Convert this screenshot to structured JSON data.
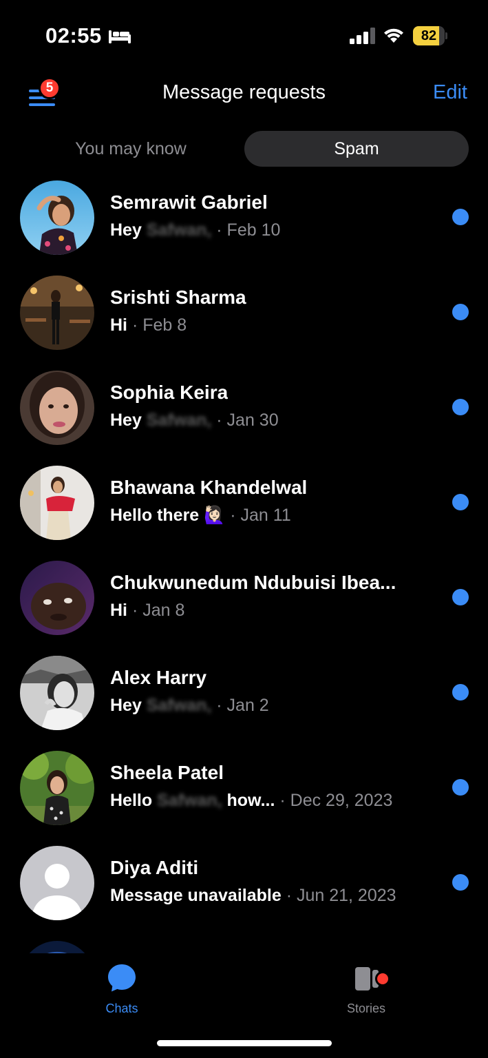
{
  "status_bar": {
    "time": "02:55",
    "battery": "82",
    "battery_level": 0.82,
    "icons": [
      "bed-icon",
      "signal-icon",
      "wifi-icon",
      "battery-icon"
    ]
  },
  "header": {
    "menu_badge": "5",
    "title": "Message requests",
    "edit_label": "Edit"
  },
  "tabs": [
    {
      "label": "You may know",
      "selected": false
    },
    {
      "label": "Spam",
      "selected": true
    }
  ],
  "requests": [
    {
      "name": "Semrawit Gabriel",
      "message": "Hey",
      "blurred": "Safwan,",
      "date": "Feb 10",
      "unread": true
    },
    {
      "name": "Srishti Sharma",
      "message": "Hi",
      "blurred": "",
      "date": "Feb 8",
      "unread": true
    },
    {
      "name": "Sophia Keira",
      "message": "Hey",
      "blurred": "Safwan,",
      "date": "Jan 30",
      "unread": true
    },
    {
      "name": "Bhawana Khandelwal",
      "message": "Hello there 🙋🏻‍♀️",
      "blurred": "",
      "date": "Jan 11",
      "unread": true
    },
    {
      "name": "Chukwunedum Ndubuisi Ibea...",
      "message": "Hi",
      "blurred": "",
      "date": "Jan 8",
      "unread": true
    },
    {
      "name": "Alex Harry",
      "message": "Hey",
      "blurred": "Safwan,",
      "date": "Jan 2",
      "unread": true
    },
    {
      "name": "Sheela Patel",
      "message": "Hello",
      "blurred": "Safwan,",
      "message_suffix": "how...",
      "date": "Dec 29, 2023",
      "unread": true
    },
    {
      "name": "Diya Aditi",
      "message": "Message unavailable",
      "blurred": "",
      "date": "Jun 21, 2023",
      "unread": true
    }
  ],
  "separator": "·",
  "tab_bar": {
    "items": [
      {
        "label": "Chats",
        "icon": "chat-bubble-icon",
        "active": true
      },
      {
        "label": "Stories",
        "icon": "stories-icon",
        "active": false,
        "has_badge": true
      }
    ]
  },
  "colors": {
    "accent": "#3b8cf6",
    "badge": "#ff3b30",
    "battery": "#f4d03f",
    "secondary_text": "#8e8e93"
  }
}
